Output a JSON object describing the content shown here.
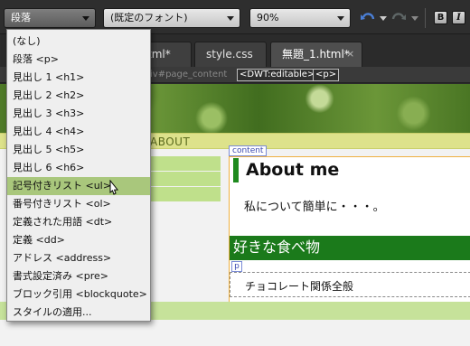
{
  "toolbar": {
    "format_value": "段落",
    "font_value": "(既定のフォント)",
    "size_value": "90%",
    "bold_label": "B",
    "italic_label": "I",
    "undo_icon": "undo-icon",
    "redo_icon": "redo-icon"
  },
  "tabs": [
    {
      "label": "tml*"
    },
    {
      "label": "style.css"
    },
    {
      "label": "無題_1.html*",
      "close": "×",
      "active": true
    }
  ],
  "tag_selector": {
    "faded": "iv#page_content",
    "items": [
      "<DWT:editable>",
      "<p>"
    ]
  },
  "page": {
    "nav_label": "ABOUT",
    "content_label": "content",
    "heading": "About me",
    "intro": "私について簡単に・・・。",
    "section_heading": "好きな食べ物",
    "p_label": "p",
    "paragraph": "チョコレート関係全般"
  },
  "menu": {
    "items": [
      {
        "label": "(なし)"
      },
      {
        "label": "段落 <p>"
      },
      {
        "label": "見出し 1 <h1>"
      },
      {
        "label": "見出し 2 <h2>"
      },
      {
        "label": "見出し 3 <h3>"
      },
      {
        "label": "見出し 4 <h4>"
      },
      {
        "label": "見出し 5 <h5>"
      },
      {
        "label": "見出し 6 <h6>"
      },
      {
        "label": "記号付きリスト <ul>",
        "highlighted": true
      },
      {
        "label": "番号付きリスト <ol>"
      },
      {
        "label": "定義された用語 <dt>"
      },
      {
        "label": "定義 <dd>"
      },
      {
        "label": "アドレス <address>"
      },
      {
        "label": "書式設定済み <pre>"
      },
      {
        "label": "ブロック引用 <blockquote>"
      },
      {
        "label": "スタイルの適用..."
      }
    ]
  },
  "colors": {
    "highlight": "#a9c77c",
    "heading_bar": "#1b7a1b",
    "content_border": "#efb040"
  }
}
